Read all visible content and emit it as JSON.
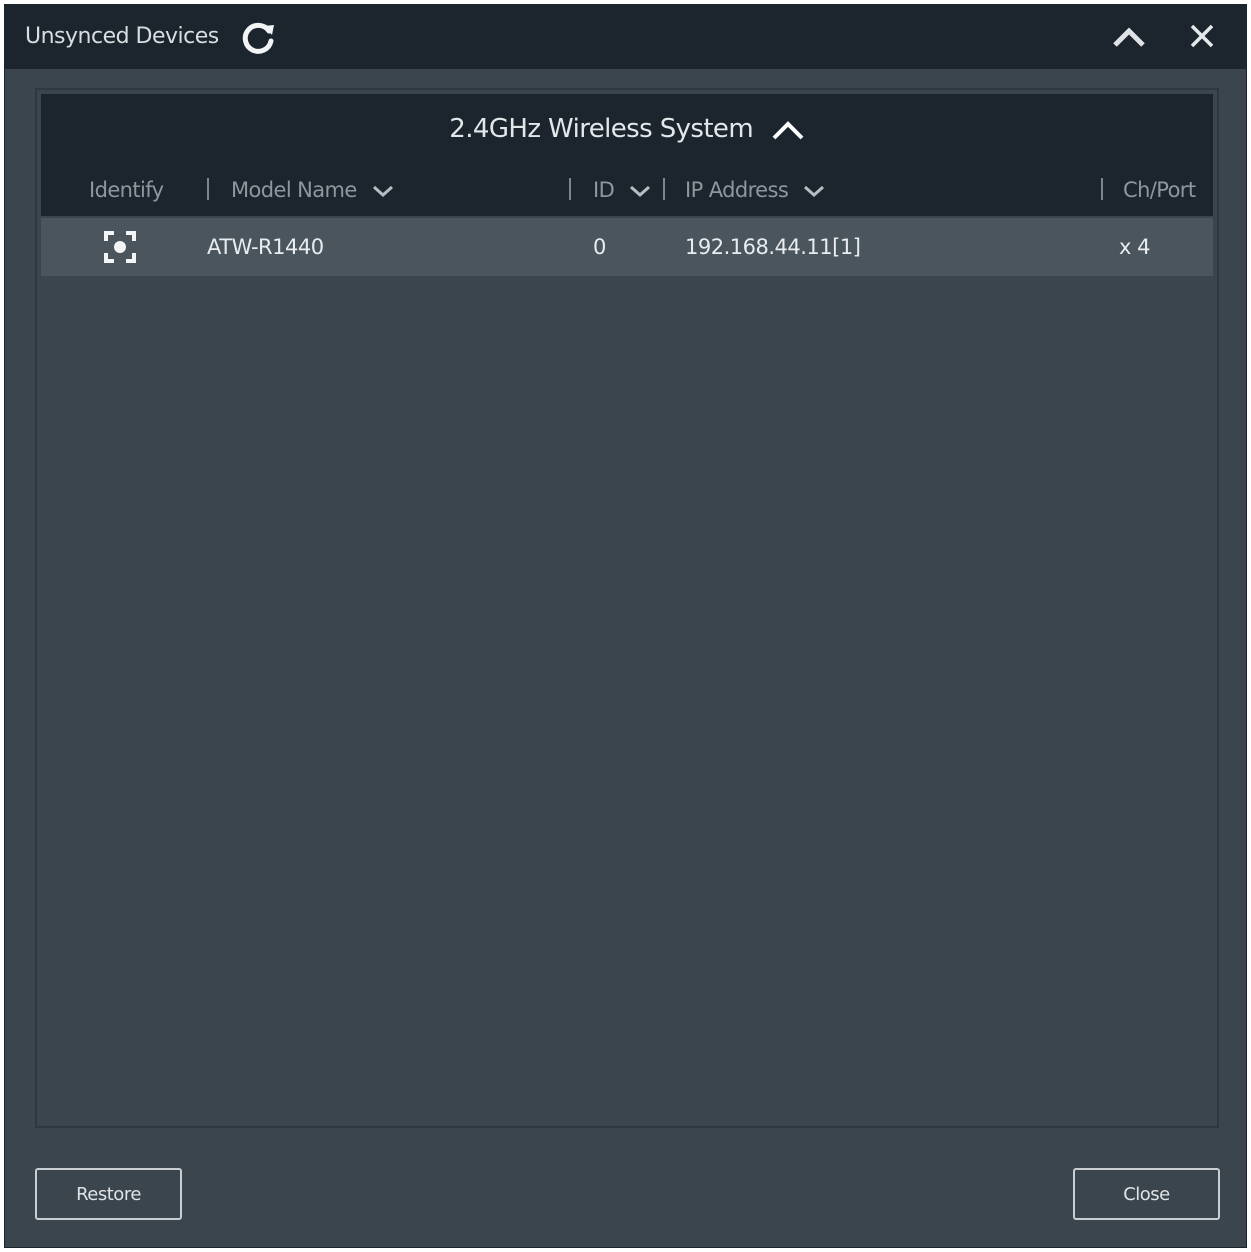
{
  "window": {
    "title": "Unsynced Devices"
  },
  "group": {
    "title": "2.4GHz Wireless System"
  },
  "columns": {
    "identify": "Identify",
    "model_name": "Model Name",
    "id": "ID",
    "ip_address": "IP Address",
    "ch_port": "Ch/Port"
  },
  "rows": [
    {
      "model_name": "ATW-R1440",
      "id": "0",
      "ip_address": "192.168.44.11[1]",
      "ch_port": "x 4"
    }
  ],
  "buttons": {
    "restore": "Restore",
    "close": "Close"
  },
  "icons": {
    "refresh": "refresh-icon",
    "collapse": "chevron-up-icon",
    "close": "close-icon",
    "identify": "identify-target-icon",
    "sort": "chevron-down-icon"
  }
}
